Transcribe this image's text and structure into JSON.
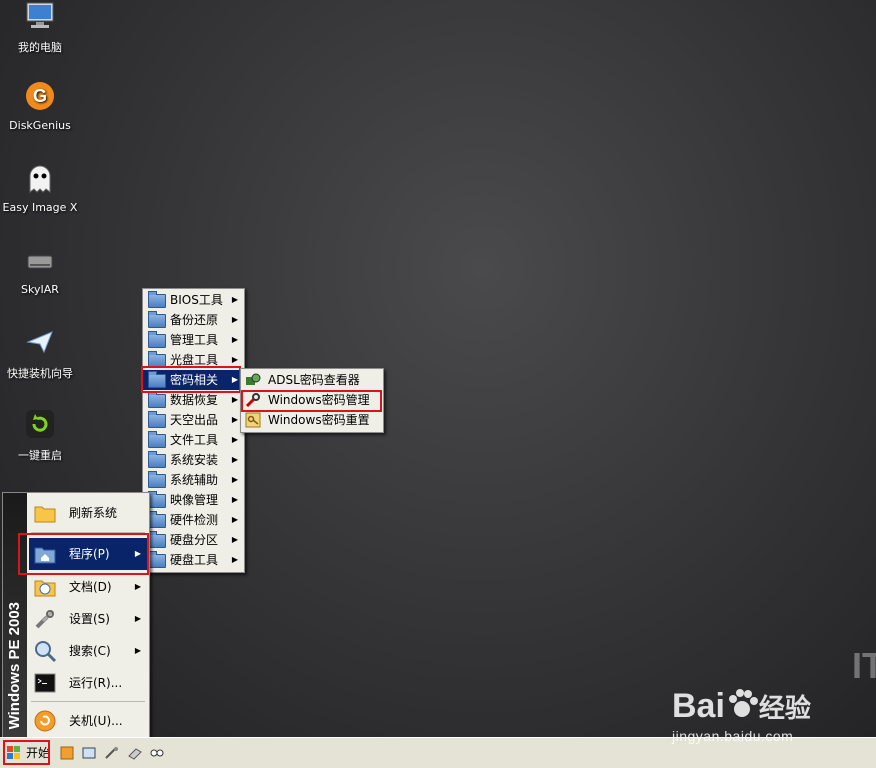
{
  "desktop": {
    "icons": [
      {
        "label": "我的电脑",
        "icon": "computer-icon"
      },
      {
        "label": "DiskGenius",
        "icon": "diskgenius-icon"
      },
      {
        "label": "Easy Image X",
        "icon": "ghost-icon"
      },
      {
        "label": "SkyIAR",
        "icon": "drive-icon"
      },
      {
        "label": "快捷装机向导",
        "icon": "plane-icon"
      },
      {
        "label": "一键重启",
        "icon": "restart-icon"
      }
    ]
  },
  "start_menu": {
    "band_text": "Windows PE 2003",
    "items": [
      {
        "label": "刷新系统",
        "icon": "folder-icon"
      },
      {
        "label": "程序(P)",
        "icon": "programs-icon",
        "selected": true
      },
      {
        "label": "文档(D)",
        "icon": "documents-icon"
      },
      {
        "label": "设置(S)",
        "icon": "settings-icon"
      },
      {
        "label": "搜索(C)",
        "icon": "search-icon"
      },
      {
        "label": "运行(R)...",
        "icon": "run-icon"
      },
      {
        "label": "关机(U)...",
        "icon": "shutdown-icon"
      }
    ]
  },
  "programs_menu": {
    "items": [
      {
        "label": "BIOS工具"
      },
      {
        "label": "备份还原"
      },
      {
        "label": "管理工具"
      },
      {
        "label": "光盘工具"
      },
      {
        "label": "密码相关",
        "selected": true
      },
      {
        "label": "数据恢复"
      },
      {
        "label": "天空出品"
      },
      {
        "label": "文件工具"
      },
      {
        "label": "系统安装"
      },
      {
        "label": "系统辅助"
      },
      {
        "label": "映像管理"
      },
      {
        "label": "硬件检测"
      },
      {
        "label": "硬盘分区"
      },
      {
        "label": "硬盘工具"
      }
    ]
  },
  "password_menu": {
    "items": [
      {
        "label": "ADSL密码查看器",
        "icon": "adsl-icon"
      },
      {
        "label": "Windows密码管理",
        "icon": "key-tool-icon"
      },
      {
        "label": "Windows密码重置",
        "icon": "key-icon"
      }
    ]
  },
  "taskbar": {
    "start_label": "开始"
  },
  "watermark": {
    "brand": "Bai",
    "brand_suffix": "经验",
    "url": "jingyan.baidu.com",
    "corner": "ITi"
  },
  "colors": {
    "menu_bg": "#efefe7",
    "selection": "#0a246a",
    "highlight_box": "#d9141b"
  }
}
